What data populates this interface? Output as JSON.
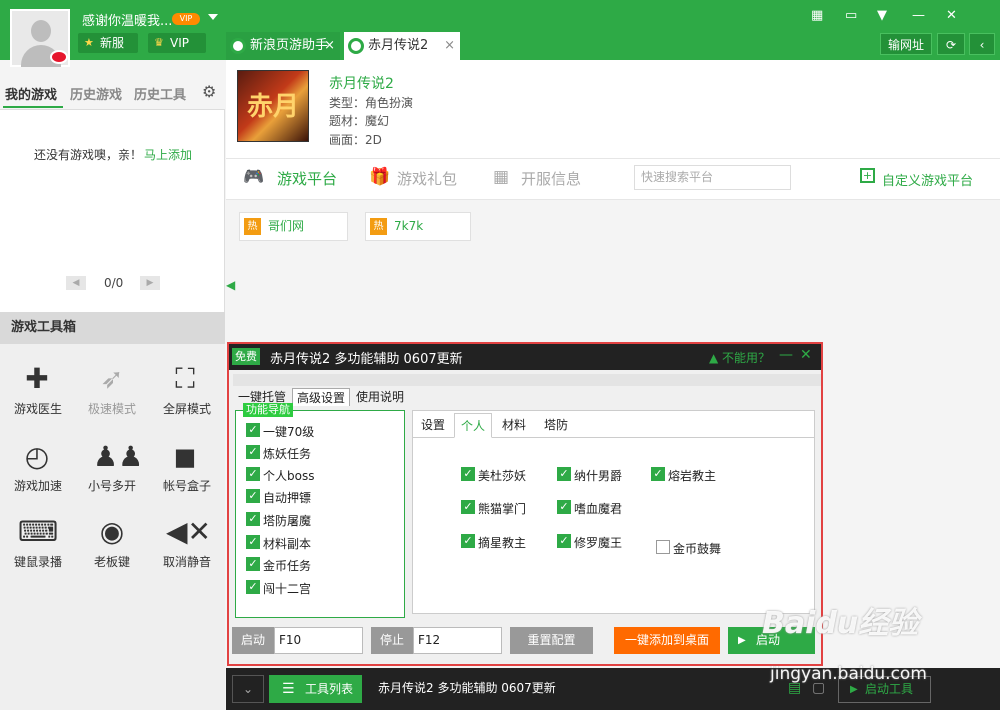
{
  "user": {
    "name": "感谢你温暖我...",
    "vip_badge": "VIP",
    "btn_new": "新服",
    "btn_vip": "VIP"
  },
  "tabs": [
    {
      "label": "新浪页游助手",
      "close": "×"
    },
    {
      "label": "赤月传说2",
      "close": "×"
    }
  ],
  "header": {
    "icons": [
      "calendar-icon",
      "chat-icon",
      "menu-icon",
      "minimize-icon",
      "close-icon"
    ],
    "btn_url": "输网址"
  },
  "sidebar": {
    "tabs": [
      "我的游戏",
      "历史游戏",
      "历史工具"
    ],
    "empty_text": "还没有游戏噢，亲！",
    "empty_link": "马上添加",
    "pager": "0/0",
    "toolbox_title": "游戏工具箱",
    "tools": [
      {
        "label": "游戏医生",
        "icon": "first-aid-icon",
        "disabled": false
      },
      {
        "label": "极速模式",
        "icon": "rocket-icon",
        "disabled": true
      },
      {
        "label": "全屏模式",
        "icon": "fullscreen-icon",
        "disabled": false
      },
      {
        "label": "游戏加速",
        "icon": "speedometer-icon",
        "disabled": false
      },
      {
        "label": "小号多开",
        "icon": "multi-user-icon",
        "disabled": false
      },
      {
        "label": "帐号盒子",
        "icon": "box-icon",
        "disabled": false
      },
      {
        "label": "键鼠录播",
        "icon": "keyboard-icon",
        "disabled": false
      },
      {
        "label": "老板键",
        "icon": "eye-icon",
        "disabled": false
      },
      {
        "label": "取消静音",
        "icon": "mute-icon",
        "disabled": false
      }
    ]
  },
  "game": {
    "cover_text": "赤月",
    "name": "赤月传说2",
    "type": "类型：角色扮演",
    "theme": "题材：魔幻",
    "graphics": "画面：2D"
  },
  "subnav": {
    "items": [
      {
        "label": "游戏平台",
        "icon": "gamepad-icon",
        "active": true
      },
      {
        "label": "游戏礼包",
        "icon": "gift-icon",
        "active": false
      },
      {
        "label": "开服信息",
        "icon": "calendar-icon",
        "active": false
      }
    ],
    "search_placeholder": "快速搜索平台",
    "custom": "自定义游戏平台"
  },
  "platforms": [
    {
      "hot": "热",
      "name": "哥们网"
    },
    {
      "hot": "热",
      "name": "7k7k"
    }
  ],
  "dialog": {
    "free": "免费",
    "title": "赤月传说2 多功能辅助 0607更新",
    "cant_use": "不能用？",
    "tabs": [
      "一键托管",
      "高级设置",
      "使用说明"
    ],
    "nav_label": "功能导航",
    "nav_items": [
      "一键70级",
      "炼妖任务",
      "个人boss",
      "自动押镖",
      "塔防屠魔",
      "材料副本",
      "金币任务",
      "闯十二宫"
    ],
    "inner_tabs": [
      "设置",
      "个人",
      "材料",
      "塔防"
    ],
    "options": [
      {
        "label": "美杜莎妖",
        "checked": true
      },
      {
        "label": "纳什男爵",
        "checked": true
      },
      {
        "label": "熔岩教主",
        "checked": true
      },
      {
        "label": "熊猫掌门",
        "checked": true
      },
      {
        "label": "嗜血魔君",
        "checked": true
      },
      {
        "label": "摘星教主",
        "checked": true
      },
      {
        "label": "修罗魔王",
        "checked": true
      },
      {
        "label": "金币鼓舞",
        "checked": false
      }
    ],
    "start_label": "启动",
    "start_key": "F10",
    "stop_label": "停止",
    "stop_key": "F12",
    "reset": "重置配置",
    "add_desktop": "一键添加到桌面",
    "start_btn": "启动"
  },
  "bottombar": {
    "tool_list": "工具列表",
    "title": "赤月传说2 多功能辅助 0607更新",
    "start_tool": "启动工具"
  },
  "watermark": {
    "logo": "Baidu经验",
    "url": "jingyan.baidu.com"
  }
}
